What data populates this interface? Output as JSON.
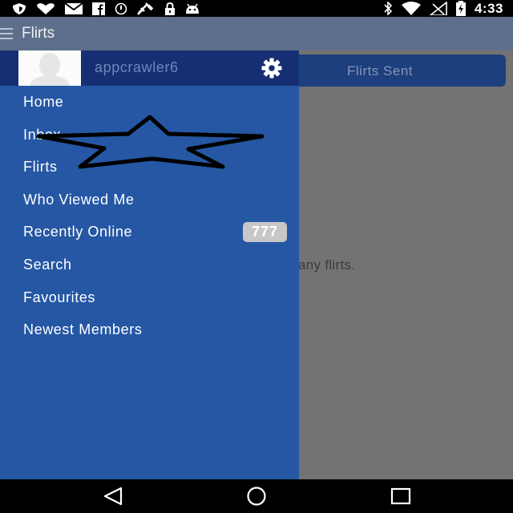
{
  "status_bar": {
    "time": "4:33",
    "icons": [
      "shield-icon",
      "heart-icon",
      "mail-icon",
      "facebook-icon",
      "sync-icon",
      "satellite-icon",
      "lock-icon",
      "android-icon",
      "bluetooth-icon",
      "wifi-icon",
      "no-signal-icon",
      "battery-icon"
    ]
  },
  "app_bar": {
    "title": "Flirts"
  },
  "content": {
    "tab_sent_label": "Flirts Sent",
    "empty_message": "any flirts."
  },
  "drawer": {
    "username": "appcrawler6",
    "items": [
      {
        "label": "Home"
      },
      {
        "label": "Inbox"
      },
      {
        "label": "Flirts"
      },
      {
        "label": "Who Viewed Me"
      },
      {
        "label": "Recently Online",
        "badge": "777"
      },
      {
        "label": "Search"
      },
      {
        "label": "Favourites"
      },
      {
        "label": "Newest Members"
      }
    ]
  },
  "colors": {
    "drawer": "#2557a4",
    "drawer_header": "#162f74",
    "app_bar": "#5d6f8a",
    "tab": "#1d3f7d",
    "scrim_content": "#737373"
  }
}
